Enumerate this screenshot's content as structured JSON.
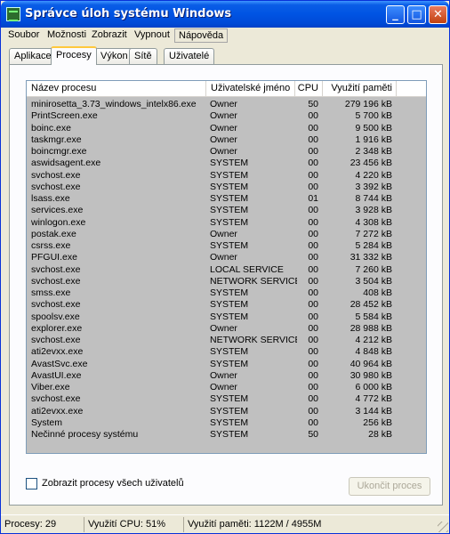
{
  "window": {
    "title": "Správce úloh systému Windows"
  },
  "menu": {
    "items": [
      "Soubor",
      "Možnosti",
      "Zobrazit",
      "Vypnout",
      "Nápověda"
    ]
  },
  "tabs": [
    "Aplikace",
    "Procesy",
    "Výkon",
    "Sítě",
    "Uživatelé"
  ],
  "active_tab": "Procesy",
  "columns": {
    "name": "Název procesu",
    "user": "Uživatelské jméno",
    "cpu": "CPU",
    "mem": "Využití paměti"
  },
  "processes": [
    {
      "name": "minirosetta_3.73_windows_intelx86.exe",
      "user": "Owner",
      "cpu": "50",
      "mem": "279 196 kB"
    },
    {
      "name": "PrintScreen.exe",
      "user": "Owner",
      "cpu": "00",
      "mem": "5 700 kB"
    },
    {
      "name": "boinc.exe",
      "user": "Owner",
      "cpu": "00",
      "mem": "9 500 kB"
    },
    {
      "name": "taskmgr.exe",
      "user": "Owner",
      "cpu": "00",
      "mem": "1 916 kB"
    },
    {
      "name": "boincmgr.exe",
      "user": "Owner",
      "cpu": "00",
      "mem": "2 348 kB"
    },
    {
      "name": "aswidsagent.exe",
      "user": "SYSTEM",
      "cpu": "00",
      "mem": "23 456 kB"
    },
    {
      "name": "svchost.exe",
      "user": "SYSTEM",
      "cpu": "00",
      "mem": "4 220 kB"
    },
    {
      "name": "svchost.exe",
      "user": "SYSTEM",
      "cpu": "00",
      "mem": "3 392 kB"
    },
    {
      "name": "lsass.exe",
      "user": "SYSTEM",
      "cpu": "01",
      "mem": "8 744 kB"
    },
    {
      "name": "services.exe",
      "user": "SYSTEM",
      "cpu": "00",
      "mem": "3 928 kB"
    },
    {
      "name": "winlogon.exe",
      "user": "SYSTEM",
      "cpu": "00",
      "mem": "4 308 kB"
    },
    {
      "name": "postak.exe",
      "user": "Owner",
      "cpu": "00",
      "mem": "7 272 kB"
    },
    {
      "name": "csrss.exe",
      "user": "SYSTEM",
      "cpu": "00",
      "mem": "5 284 kB"
    },
    {
      "name": "PFGUI.exe",
      "user": "Owner",
      "cpu": "00",
      "mem": "31 332 kB"
    },
    {
      "name": "svchost.exe",
      "user": "LOCAL SERVICE",
      "cpu": "00",
      "mem": "7 260 kB"
    },
    {
      "name": "svchost.exe",
      "user": "NETWORK SERVICE",
      "cpu": "00",
      "mem": "3 504 kB"
    },
    {
      "name": "smss.exe",
      "user": "SYSTEM",
      "cpu": "00",
      "mem": "408 kB"
    },
    {
      "name": "svchost.exe",
      "user": "SYSTEM",
      "cpu": "00",
      "mem": "28 452 kB"
    },
    {
      "name": "spoolsv.exe",
      "user": "SYSTEM",
      "cpu": "00",
      "mem": "5 584 kB"
    },
    {
      "name": "explorer.exe",
      "user": "Owner",
      "cpu": "00",
      "mem": "28 988 kB"
    },
    {
      "name": "svchost.exe",
      "user": "NETWORK SERVICE",
      "cpu": "00",
      "mem": "4 212 kB"
    },
    {
      "name": "ati2evxx.exe",
      "user": "SYSTEM",
      "cpu": "00",
      "mem": "4 848 kB"
    },
    {
      "name": "AvastSvc.exe",
      "user": "SYSTEM",
      "cpu": "00",
      "mem": "40 964 kB"
    },
    {
      "name": "AvastUI.exe",
      "user": "Owner",
      "cpu": "00",
      "mem": "30 980 kB"
    },
    {
      "name": "Viber.exe",
      "user": "Owner",
      "cpu": "00",
      "mem": "6 000 kB"
    },
    {
      "name": "svchost.exe",
      "user": "SYSTEM",
      "cpu": "00",
      "mem": "4 772 kB"
    },
    {
      "name": "ati2evxx.exe",
      "user": "SYSTEM",
      "cpu": "00",
      "mem": "3 144 kB"
    },
    {
      "name": "System",
      "user": "SYSTEM",
      "cpu": "00",
      "mem": "256 kB"
    },
    {
      "name": "Nečinné procesy systému",
      "user": "SYSTEM",
      "cpu": "50",
      "mem": "28 kB"
    }
  ],
  "show_all_users": {
    "label": "Zobrazit procesy všech uživatelů",
    "checked": false
  },
  "end_process_label": "Ukončit proces",
  "status": {
    "processes": "Procesy: 29",
    "cpu": "Využití CPU: 51%",
    "memory": "Využití paměti: 1122M / 4955M"
  },
  "icons": {
    "app": "task-manager-icon",
    "minimize": "minimize-icon",
    "maximize": "maximize-icon",
    "close": "close-icon",
    "grip": "resize-grip-icon"
  }
}
